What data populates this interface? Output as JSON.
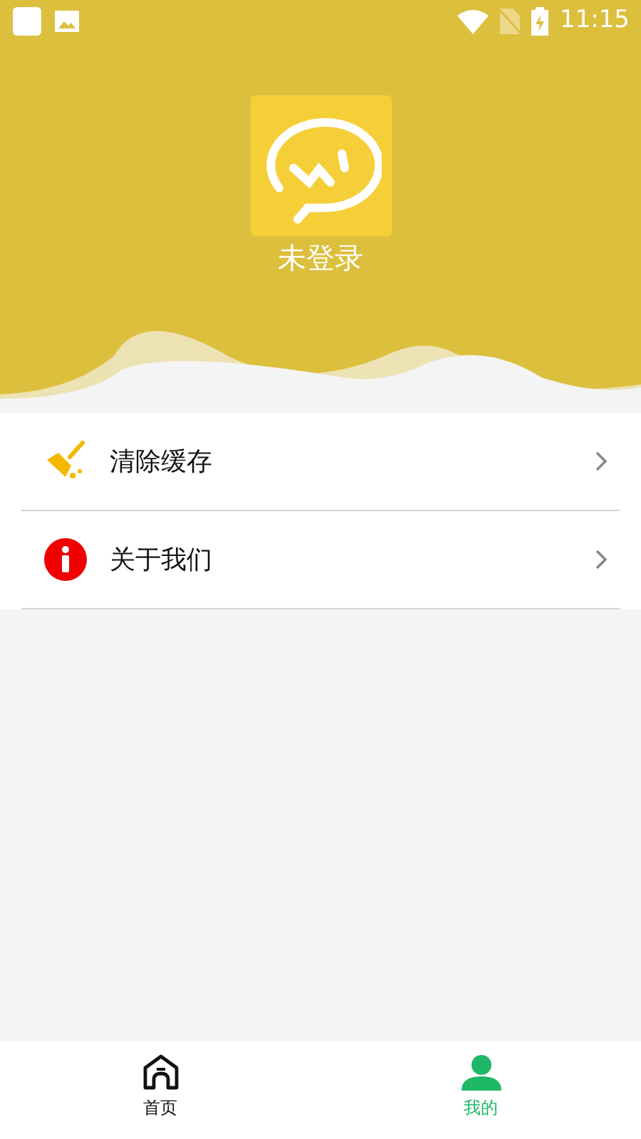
{
  "status_bar": {
    "time": "11:15"
  },
  "profile": {
    "name": "未登录"
  },
  "menu": [
    {
      "kind": "clear-cache",
      "label": "清除缓存"
    },
    {
      "kind": "about",
      "label": "关于我们"
    }
  ],
  "tabs": [
    {
      "kind": "home",
      "label": "首页",
      "selected": false
    },
    {
      "kind": "mine",
      "label": "我的",
      "selected": true
    }
  ]
}
